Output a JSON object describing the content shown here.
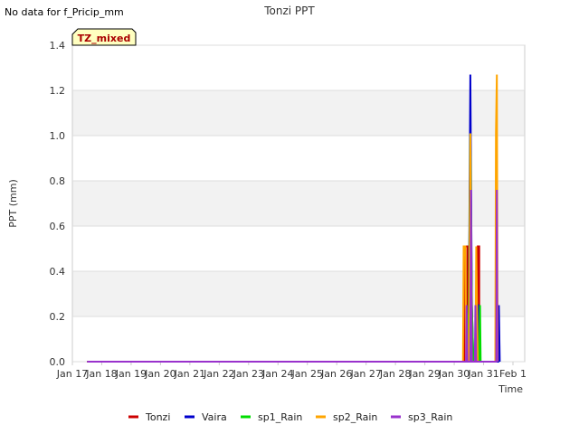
{
  "no_data_note": "No data for f_Pricip_mm",
  "chart_data": {
    "type": "line",
    "title": "Tonzi PPT",
    "xlabel": "Time",
    "ylabel": "PPT (mm)",
    "badge": "TZ_mixed",
    "xlim": [
      0,
      15.4
    ],
    "ylim": [
      0,
      1.4
    ],
    "yticks": [
      0.0,
      0.2,
      0.4,
      0.6,
      0.8,
      1.0,
      1.2,
      1.4
    ],
    "ytick_labels": [
      "0.0",
      "0.2",
      "0.4",
      "0.6",
      "0.8",
      "1.0",
      "1.2",
      "1.4"
    ],
    "xticks": [
      0,
      1,
      2,
      3,
      4,
      5,
      6,
      7,
      8,
      9,
      10,
      11,
      12,
      13,
      14,
      15
    ],
    "xtick_labels": [
      "Jan 17",
      "Jan 18",
      "Jan 19",
      "Jan 20",
      "Jan 21",
      "Jan 22",
      "Jan 23",
      "Jan 24",
      "Jan 25",
      "Jan 26",
      "Jan 27",
      "Jan 28",
      "Jan 29",
      "Jan 30",
      "Jan 31",
      "Feb 1"
    ],
    "legend_position": "bottom",
    "series": [
      {
        "name": "Tonzi",
        "color": "#cc0000",
        "points": [
          [
            0.5,
            0
          ],
          [
            13.35,
            0
          ],
          [
            13.35,
            0.51
          ],
          [
            13.45,
            0.51
          ],
          [
            13.45,
            0
          ],
          [
            13.8,
            0
          ],
          [
            13.8,
            0.51
          ],
          [
            13.85,
            0.51
          ],
          [
            13.85,
            0
          ],
          [
            14.5,
            0
          ]
        ]
      },
      {
        "name": "Vaira",
        "color": "#0000cc",
        "points": [
          [
            0.5,
            0
          ],
          [
            13.5,
            0
          ],
          [
            13.5,
            0.25
          ],
          [
            13.55,
            1.27
          ],
          [
            13.6,
            0.25
          ],
          [
            13.65,
            0
          ],
          [
            13.75,
            0
          ],
          [
            13.78,
            0.25
          ],
          [
            13.82,
            0.25
          ],
          [
            13.85,
            0
          ],
          [
            14.5,
            0
          ],
          [
            14.52,
            0.25
          ],
          [
            14.55,
            0
          ]
        ]
      },
      {
        "name": "sp1_Rain",
        "color": "#00dd00",
        "points": [
          [
            0.5,
            0
          ],
          [
            13.45,
            0
          ],
          [
            13.5,
            0.25
          ],
          [
            13.55,
            1.01
          ],
          [
            13.6,
            0.25
          ],
          [
            13.65,
            0
          ],
          [
            13.85,
            0
          ],
          [
            13.88,
            0.25
          ],
          [
            13.9,
            0
          ]
        ]
      },
      {
        "name": "sp2_Rain",
        "color": "#ffa500",
        "points": [
          [
            0.5,
            0
          ],
          [
            13.3,
            0
          ],
          [
            13.32,
            0.51
          ],
          [
            13.38,
            0.51
          ],
          [
            13.4,
            0
          ],
          [
            13.5,
            0
          ],
          [
            13.55,
            1.01
          ],
          [
            13.6,
            0
          ],
          [
            13.72,
            0
          ],
          [
            13.75,
            0.51
          ],
          [
            13.8,
            0
          ],
          [
            14.4,
            0
          ],
          [
            14.42,
            1.01
          ],
          [
            14.45,
            1.27
          ],
          [
            14.48,
            0
          ]
        ]
      },
      {
        "name": "sp3_Rain",
        "color": "#9932cc",
        "points": [
          [
            0.5,
            0
          ],
          [
            13.4,
            0
          ],
          [
            13.42,
            0.25
          ],
          [
            13.45,
            0
          ],
          [
            13.55,
            0
          ],
          [
            13.57,
            0.76
          ],
          [
            13.6,
            0
          ],
          [
            13.7,
            0
          ],
          [
            13.72,
            0.25
          ],
          [
            13.75,
            0
          ],
          [
            14.43,
            0
          ],
          [
            14.45,
            0.76
          ],
          [
            14.47,
            0
          ]
        ]
      }
    ]
  }
}
